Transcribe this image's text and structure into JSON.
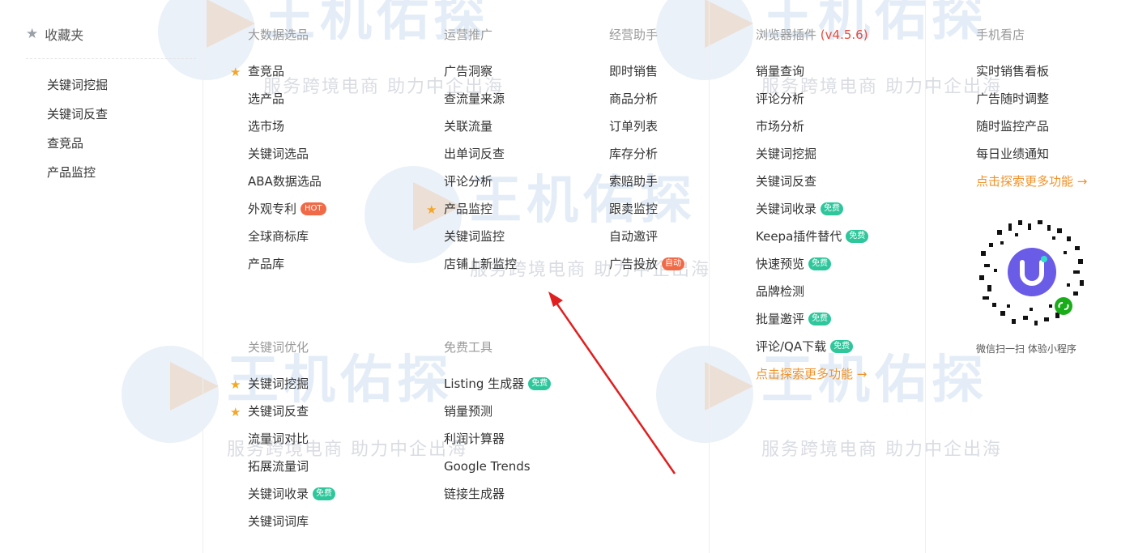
{
  "watermark": {
    "logo_text": "王机佑探",
    "slogan": "服务跨境电商 助力中企出海"
  },
  "favorites": {
    "title": "收藏夹",
    "items": [
      {
        "label": "关键词挖掘"
      },
      {
        "label": "关键词反查"
      },
      {
        "label": "查竞品"
      },
      {
        "label": "产品监控"
      }
    ]
  },
  "big_data": {
    "title": "大数据选品",
    "items": [
      {
        "label": "查竞品",
        "starred": true
      },
      {
        "label": "选产品"
      },
      {
        "label": "选市场"
      },
      {
        "label": "关键词选品"
      },
      {
        "label": "ABA数据选品"
      },
      {
        "label": "外观专利",
        "badge": "HOT",
        "badge_type": "hot"
      },
      {
        "label": "全球商标库"
      },
      {
        "label": "产品库"
      }
    ]
  },
  "operations": {
    "title": "运营推广",
    "items": [
      {
        "label": "广告洞察"
      },
      {
        "label": "查流量来源"
      },
      {
        "label": "关联流量"
      },
      {
        "label": "出单词反查"
      },
      {
        "label": "评论分析"
      },
      {
        "label": "产品监控",
        "starred": true
      },
      {
        "label": "关键词监控"
      },
      {
        "label": "店铺上新监控"
      }
    ]
  },
  "assistant": {
    "title": "经营助手",
    "items": [
      {
        "label": "即时销售"
      },
      {
        "label": "商品分析"
      },
      {
        "label": "订单列表"
      },
      {
        "label": "库存分析"
      },
      {
        "label": "索赔助手"
      },
      {
        "label": "跟卖监控"
      },
      {
        "label": "自动邀评"
      },
      {
        "label": "广告投放",
        "badge": "自动",
        "badge_type": "auto"
      }
    ]
  },
  "plugin": {
    "title": "浏览器插件",
    "version": "(v4.5.6)",
    "items": [
      {
        "label": "销量查询"
      },
      {
        "label": "评论分析"
      },
      {
        "label": "市场分析"
      },
      {
        "label": "关键词挖掘"
      },
      {
        "label": "关键词反查"
      },
      {
        "label": "关键词收录",
        "badge": "免费",
        "badge_type": "free"
      },
      {
        "label": "Keepa插件替代",
        "badge": "免费",
        "badge_type": "free"
      },
      {
        "label": "快速预览",
        "badge": "免费",
        "badge_type": "free"
      },
      {
        "label": "品牌检测"
      },
      {
        "label": "批量邀评",
        "badge": "免费",
        "badge_type": "free"
      },
      {
        "label": "评论/QA下载",
        "badge": "免费",
        "badge_type": "free"
      },
      {
        "label": "点击探索更多功能 →",
        "more": true
      }
    ]
  },
  "mobile": {
    "title": "手机看店",
    "items": [
      {
        "label": "实时销售看板"
      },
      {
        "label": "广告随时调整"
      },
      {
        "label": "随时监控产品"
      },
      {
        "label": "每日业绩通知"
      },
      {
        "label": "点击探索更多功能 →",
        "more": true
      }
    ],
    "qr_caption": "微信扫一扫 体验小程序"
  },
  "keyword_opt": {
    "title": "关键词优化",
    "items": [
      {
        "label": "关键词挖掘",
        "starred": true
      },
      {
        "label": "关键词反查",
        "starred": true
      },
      {
        "label": "流量词对比"
      },
      {
        "label": "拓展流量词"
      },
      {
        "label": "关键词收录",
        "badge": "免费",
        "badge_type": "free"
      },
      {
        "label": "关键词词库"
      }
    ]
  },
  "free_tools": {
    "title": "免费工具",
    "items": [
      {
        "label": "Listing 生成器",
        "badge": "免费",
        "badge_type": "free"
      },
      {
        "label": "销量预测"
      },
      {
        "label": "利润计算器"
      },
      {
        "label": "Google Trends"
      },
      {
        "label": "链接生成器"
      }
    ]
  },
  "colors": {
    "star": "#f5a623",
    "free_badge": "#2ec69b",
    "hot_badge": "#f06a47",
    "more_link": "#f0932b",
    "version": "#e84c3d",
    "arrow": "#e02020"
  }
}
